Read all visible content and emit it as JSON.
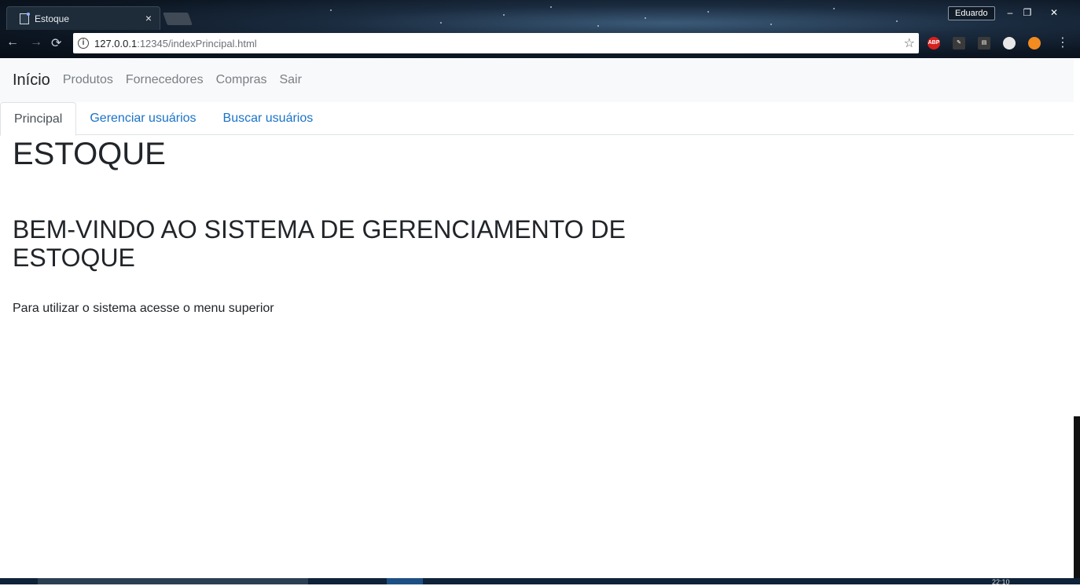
{
  "browser": {
    "tab_title": "Estoque",
    "tab_close": "×",
    "profile_name": "Eduardo",
    "window_buttons": {
      "minimize": "–",
      "restore": "❐",
      "close": "✕"
    },
    "nav": {
      "back": "←",
      "forward": "→",
      "reload": "⟳"
    },
    "url_host": "127.0.0.1",
    "url_rest": ":12345/indexPrincipal.html",
    "info_icon": "i",
    "bookmark_star": "☆",
    "extensions": [
      {
        "name": "adblock-icon",
        "label": "ABP",
        "color": "#d62020"
      },
      {
        "name": "pen-icon",
        "label": "✎",
        "color": "#3a3a3a"
      },
      {
        "name": "extension-icon",
        "label": "▤",
        "color": "#3a3a3a"
      },
      {
        "name": "circle-icon",
        "label": "",
        "color": "#e8e8e8"
      },
      {
        "name": "orange-ext-icon",
        "label": "",
        "color": "#f28b20"
      }
    ],
    "menu": "⋮"
  },
  "navbar": {
    "brand": "Início",
    "links": [
      "Produtos",
      "Fornecedores",
      "Compras",
      "Sair"
    ]
  },
  "tabs": [
    {
      "label": "Principal",
      "active": true
    },
    {
      "label": "Gerenciar usuários",
      "active": false
    },
    {
      "label": "Buscar usuários",
      "active": false
    }
  ],
  "main": {
    "title": "ESTOQUE",
    "welcome": "BEM-VINDO AO SISTEMA DE GERENCIAMENTO DE ESTOQUE",
    "instruction": "Para utilizar o sistema acesse o menu superior"
  },
  "taskbar": {
    "clock": "22:10"
  }
}
